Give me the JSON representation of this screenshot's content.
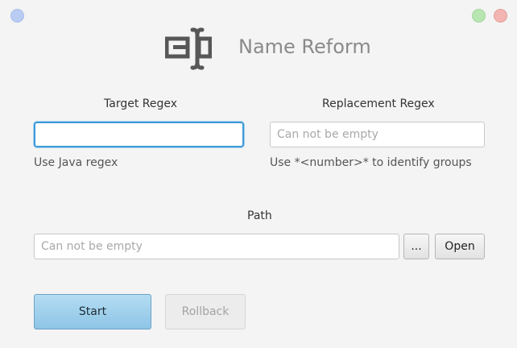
{
  "app": {
    "title": "Name Reform",
    "logo_icon": "text-cursor-box-icon"
  },
  "window_controls": {
    "left_color": "#b9ccf4",
    "minimize_color": "#b8e6b2",
    "close_color": "#f3b5b2"
  },
  "target": {
    "label": "Target Regex",
    "value": "",
    "placeholder": "",
    "hint": "Use Java regex"
  },
  "replacement": {
    "label": "Replacement Regex",
    "value": "",
    "placeholder": "Can not be empty",
    "hint": "Use *<number>* to identify groups"
  },
  "path": {
    "label": "Path",
    "value": "",
    "placeholder": "Can not be empty",
    "browse_label": "...",
    "open_label": "Open"
  },
  "actions": {
    "start_label": "Start",
    "rollback_label": "Rollback"
  }
}
